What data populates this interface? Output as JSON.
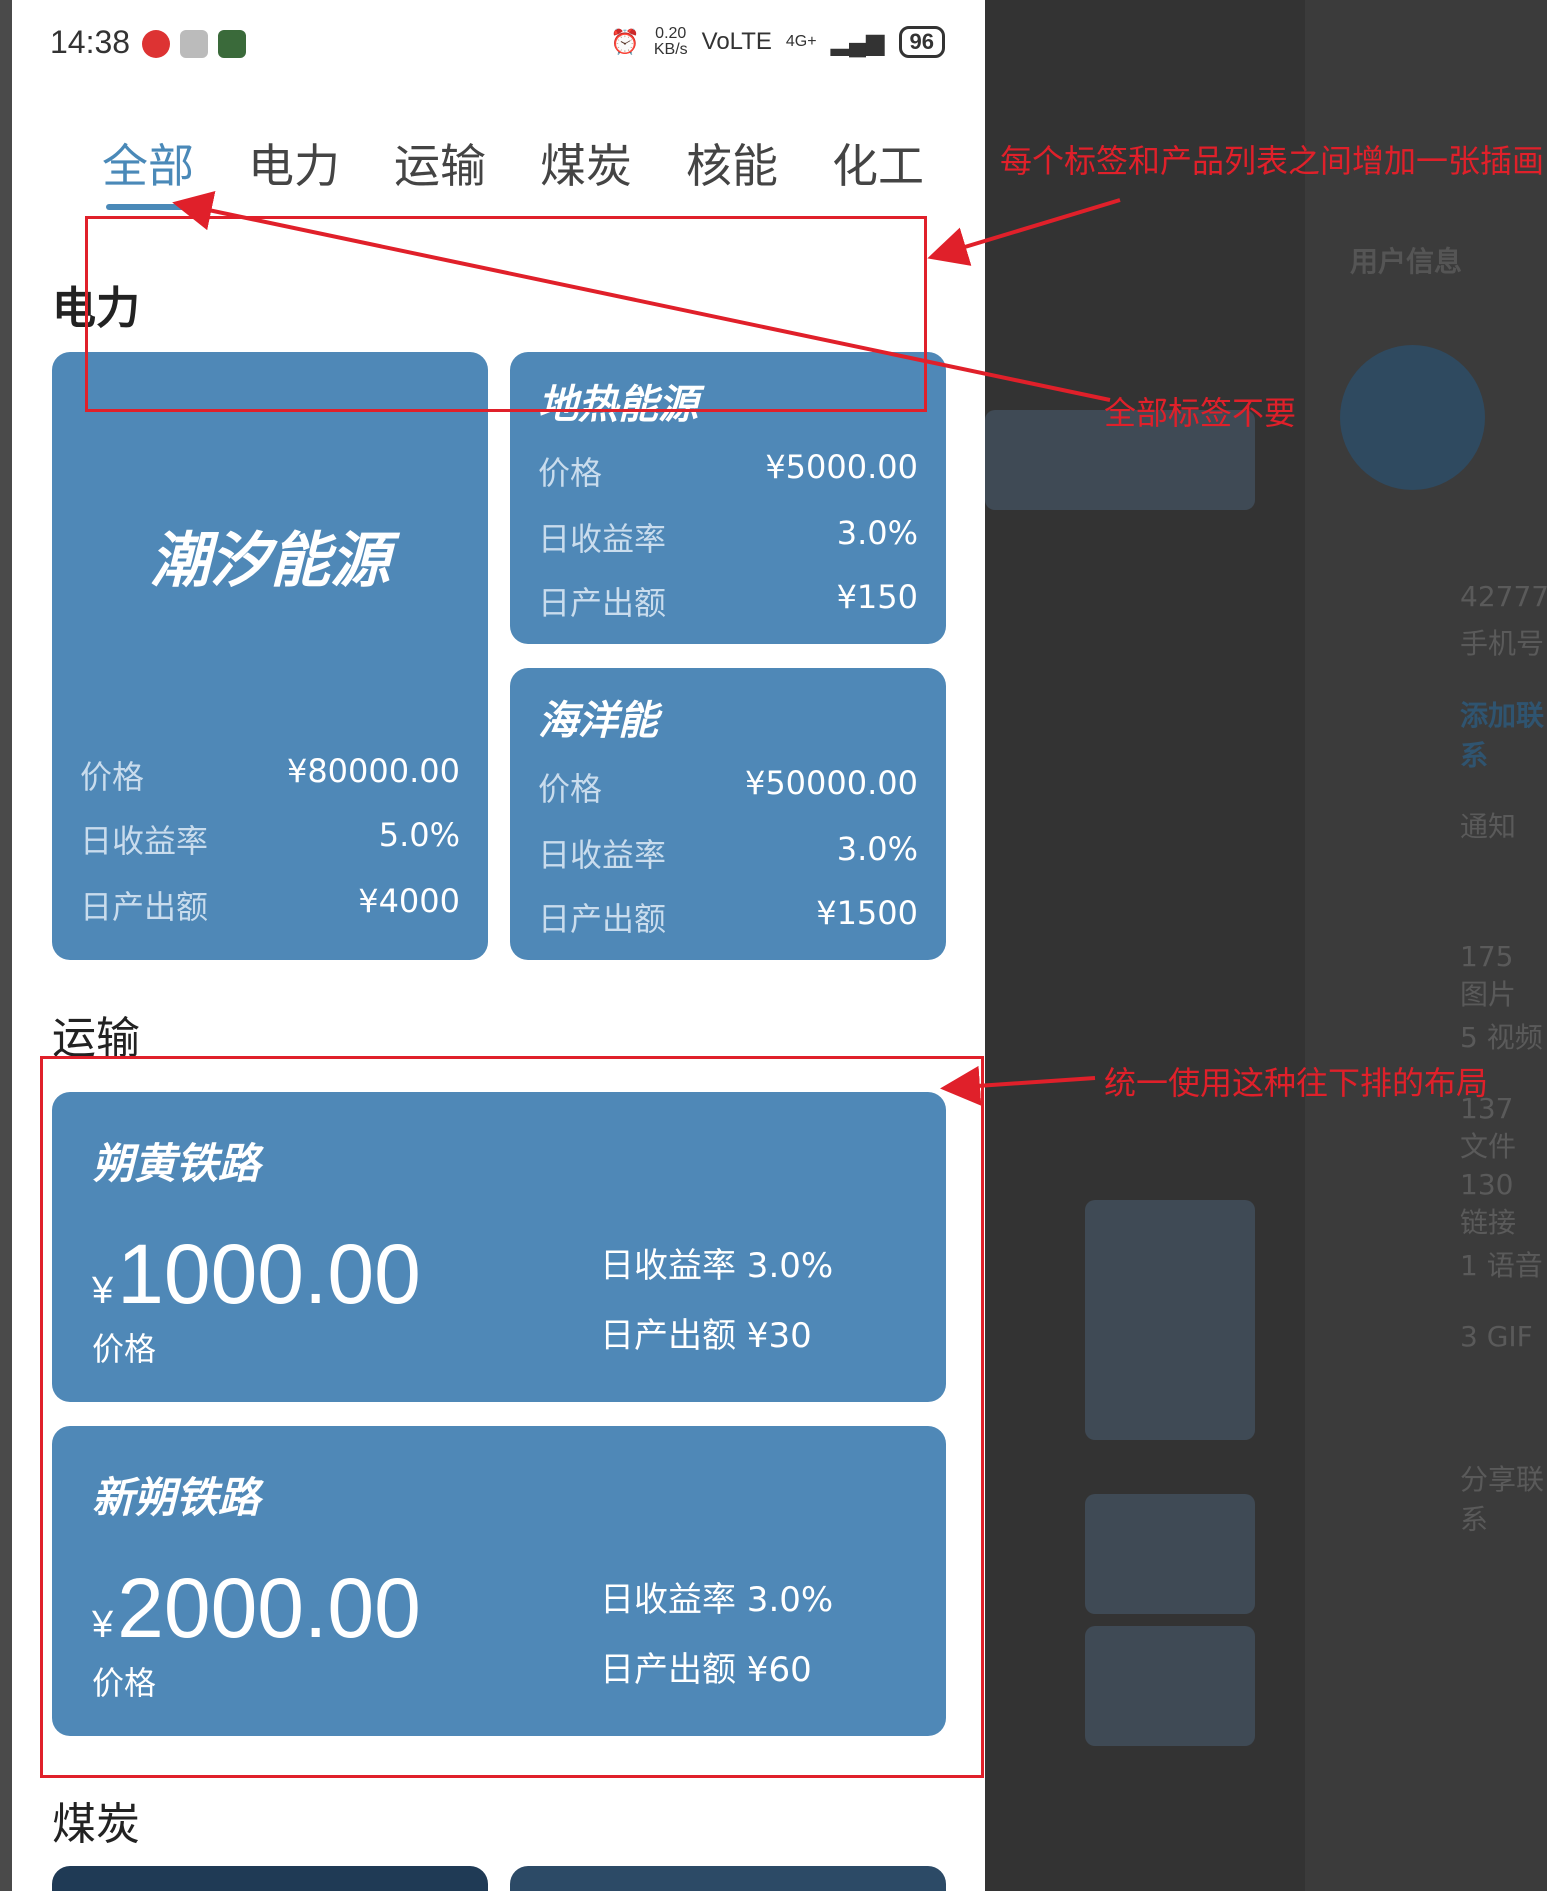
{
  "status_bar": {
    "time": "14:38",
    "speed": "0.20",
    "speed_unit": "KB/s",
    "network": "VoLTE",
    "signal": "4G+",
    "battery": "96"
  },
  "tabs": [
    "全部",
    "电力",
    "运输",
    "煤炭",
    "核能",
    "化工"
  ],
  "sections": {
    "power": {
      "title": "电力",
      "cards": [
        {
          "name": "潮汐能源",
          "price_label": "价格",
          "price": "¥80000.00",
          "rate_label": "日收益率",
          "rate": "5.0%",
          "output_label": "日产出额",
          "output": "¥4000"
        },
        {
          "name": "地热能源",
          "price_label": "价格",
          "price": "¥5000.00",
          "rate_label": "日收益率",
          "rate": "3.0%",
          "output_label": "日产出额",
          "output": "¥150"
        },
        {
          "name": "海洋能",
          "price_label": "价格",
          "price": "¥50000.00",
          "rate_label": "日收益率",
          "rate": "3.0%",
          "output_label": "日产出额",
          "output": "¥1500"
        }
      ]
    },
    "transport": {
      "title": "运输",
      "cards": [
        {
          "name": "朔黄铁路",
          "currency": "¥",
          "amount": "1000.00",
          "price_label": "价格",
          "rate_text": "日收益率  3.0%",
          "output_text": "日产出额  ¥30"
        },
        {
          "name": "新朔铁路",
          "currency": "¥",
          "amount": "2000.00",
          "price_label": "价格",
          "rate_text": "日收益率  3.0%",
          "output_text": "日产出额  ¥60"
        }
      ]
    },
    "coal": {
      "title": "煤炭"
    }
  },
  "annotations": {
    "illustration_note": "每个标签和产品列表之间增加一张插画",
    "remove_all_tab_note": "全部标签不要",
    "layout_note": "统一使用这种往下排的布局"
  },
  "background_panel": {
    "header": "用户信息",
    "notify": "通知",
    "add_contact": "添加联系",
    "phone_hint": "手机号",
    "phone_partial": "42777",
    "media": [
      "175 图片",
      "5 视频",
      "137 文件",
      "130 链接",
      "1 语音",
      "3 GIF"
    ],
    "share": "分享联系"
  },
  "colors": {
    "card": "#4f88b7",
    "accent": "#4a89b8",
    "annotation": "#e0202a"
  }
}
